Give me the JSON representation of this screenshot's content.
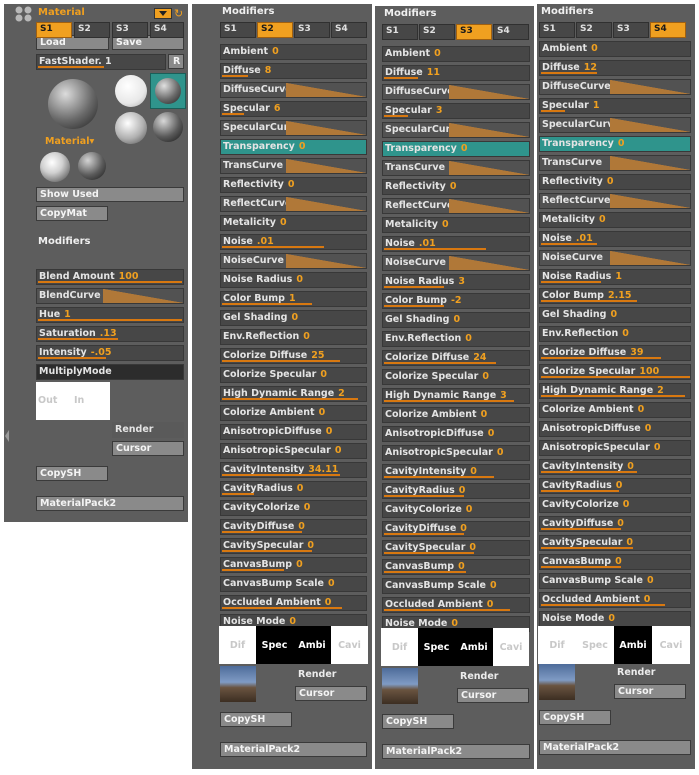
{
  "material_palette": {
    "title": "Material",
    "load_label": "Load",
    "save_label": "Save",
    "shader_name": "FastShader. 1",
    "r_label": "R",
    "material_menu_label": "Material",
    "show_used_label": "Show Used",
    "copymat_label": "CopyMat",
    "modifiers_label": "Modifiers",
    "slots": [
      "S1",
      "S2",
      "S3",
      "S4"
    ],
    "rows": [
      {
        "label": "Blend Amount",
        "value": "100"
      },
      {
        "label": "BlendCurve",
        "value": ""
      },
      {
        "label": "Hue",
        "value": "1"
      },
      {
        "label": "Saturation",
        "value": ".13"
      },
      {
        "label": "Intensity",
        "value": "-.05"
      },
      {
        "label": "MultiplyMode",
        "value": ""
      }
    ],
    "out_label": "Out",
    "in_label": "In",
    "render_label": "Render",
    "cursor_label": "Cursor",
    "copysh_label": "CopySH",
    "materialpack_label": "MaterialPack2"
  },
  "shader_panels": [
    {
      "modifiers_label": "Modifiers",
      "slots": [
        "S1",
        "S2",
        "S3",
        "S4"
      ],
      "active_slot": 1,
      "rows": [
        {
          "label": "Ambient",
          "value": "0"
        },
        {
          "label": "Diffuse",
          "value": "8"
        },
        {
          "label": "DiffuseCurve",
          "value": ""
        },
        {
          "label": "Specular",
          "value": "6"
        },
        {
          "label": "SpecularCurve",
          "value": ""
        },
        {
          "label": "Transparency",
          "value": "0"
        },
        {
          "label": "TransCurve",
          "value": ""
        },
        {
          "label": "Reflectivity",
          "value": "0"
        },
        {
          "label": "ReflectCurve",
          "value": ""
        },
        {
          "label": "Metalicity",
          "value": "0"
        },
        {
          "label": "Noise",
          "value": ".01"
        },
        {
          "label": "NoiseCurve",
          "value": ""
        },
        {
          "label": "Noise Radius",
          "value": "0"
        },
        {
          "label": "Color Bump",
          "value": "1"
        },
        {
          "label": "Gel Shading",
          "value": "0"
        },
        {
          "label": "Env.Reflection",
          "value": "0"
        },
        {
          "label": "Colorize Diffuse",
          "value": "25"
        },
        {
          "label": "Colorize Specular",
          "value": "0"
        },
        {
          "label": "High Dynamic Range",
          "value": "2"
        },
        {
          "label": "Colorize Ambient",
          "value": "0"
        },
        {
          "label": "AnisotropicDiffuse",
          "value": "0"
        },
        {
          "label": "AnisotropicSpecular",
          "value": "0"
        },
        {
          "label": "CavityIntensity",
          "value": "34.11"
        },
        {
          "label": "CavityRadius",
          "value": "0"
        },
        {
          "label": "CavityColorize",
          "value": "0"
        },
        {
          "label": "CavityDiffuse",
          "value": "0"
        },
        {
          "label": "CavitySpecular",
          "value": "0"
        },
        {
          "label": "CanvasBump",
          "value": "0"
        },
        {
          "label": "CanvasBump Scale",
          "value": "0"
        },
        {
          "label": "Occluded  Ambient",
          "value": "0"
        },
        {
          "label": "Noise Mode",
          "value": "0"
        }
      ],
      "channels": [
        "Dif",
        "Spec",
        "Ambi",
        "Cavi"
      ],
      "active_channel": 1,
      "render_label": "Render",
      "cursor_label": "Cursor",
      "copysh_label": "CopySH",
      "materialpack_label": "MaterialPack2"
    },
    {
      "modifiers_label": "Modifiers",
      "slots": [
        "S1",
        "S2",
        "S3",
        "S4"
      ],
      "active_slot": 2,
      "rows": [
        {
          "label": "Ambient",
          "value": "0"
        },
        {
          "label": "Diffuse",
          "value": "11"
        },
        {
          "label": "DiffuseCurve",
          "value": ""
        },
        {
          "label": "Specular",
          "value": "3"
        },
        {
          "label": "SpecularCurve",
          "value": ""
        },
        {
          "label": "Transparency",
          "value": "0"
        },
        {
          "label": "TransCurve",
          "value": ""
        },
        {
          "label": "Reflectivity",
          "value": "0"
        },
        {
          "label": "ReflectCurve",
          "value": ""
        },
        {
          "label": "Metalicity",
          "value": "0"
        },
        {
          "label": "Noise",
          "value": ".01"
        },
        {
          "label": "NoiseCurve",
          "value": ""
        },
        {
          "label": "Noise Radius",
          "value": "3"
        },
        {
          "label": "Color Bump",
          "value": "-2"
        },
        {
          "label": "Gel Shading",
          "value": "0"
        },
        {
          "label": "Env.Reflection",
          "value": "0"
        },
        {
          "label": "Colorize Diffuse",
          "value": "24"
        },
        {
          "label": "Colorize Specular",
          "value": "0"
        },
        {
          "label": "High Dynamic Range",
          "value": "3"
        },
        {
          "label": "Colorize Ambient",
          "value": "0"
        },
        {
          "label": "AnisotropicDiffuse",
          "value": "0"
        },
        {
          "label": "AnisotropicSpecular",
          "value": "0"
        },
        {
          "label": "CavityIntensity",
          "value": "0"
        },
        {
          "label": "CavityRadius",
          "value": "0"
        },
        {
          "label": "CavityColorize",
          "value": "0"
        },
        {
          "label": "CavityDiffuse",
          "value": "0"
        },
        {
          "label": "CavitySpecular",
          "value": "0"
        },
        {
          "label": "CanvasBump",
          "value": "0"
        },
        {
          "label": "CanvasBump Scale",
          "value": "0"
        },
        {
          "label": "Occluded  Ambient",
          "value": "0"
        },
        {
          "label": "Noise Mode",
          "value": "0"
        }
      ],
      "channels": [
        "Dif",
        "Spec",
        "Ambi",
        "Cavi"
      ],
      "active_channel": 1,
      "render_label": "Render",
      "cursor_label": "Cursor",
      "copysh_label": "CopySH",
      "materialpack_label": "MaterialPack2"
    },
    {
      "modifiers_label": "Modifiers",
      "slots": [
        "S1",
        "S2",
        "S3",
        "S4"
      ],
      "active_slot": 3,
      "rows": [
        {
          "label": "Ambient",
          "value": "0"
        },
        {
          "label": "Diffuse",
          "value": "12"
        },
        {
          "label": "DiffuseCurve",
          "value": ""
        },
        {
          "label": "Specular",
          "value": "1"
        },
        {
          "label": "SpecularCurve",
          "value": ""
        },
        {
          "label": "Transparency",
          "value": "0"
        },
        {
          "label": "TransCurve",
          "value": ""
        },
        {
          "label": "Reflectivity",
          "value": "0"
        },
        {
          "label": "ReflectCurve",
          "value": ""
        },
        {
          "label": "Metalicity",
          "value": "0"
        },
        {
          "label": "Noise",
          "value": ".01"
        },
        {
          "label": "NoiseCurve",
          "value": ""
        },
        {
          "label": "Noise Radius",
          "value": "1"
        },
        {
          "label": "Color Bump",
          "value": "2.15"
        },
        {
          "label": "Gel Shading",
          "value": "0"
        },
        {
          "label": "Env.Reflection",
          "value": "0"
        },
        {
          "label": "Colorize Diffuse",
          "value": "39"
        },
        {
          "label": "Colorize Specular",
          "value": "100"
        },
        {
          "label": "High Dynamic Range",
          "value": "2"
        },
        {
          "label": "Colorize Ambient",
          "value": "0"
        },
        {
          "label": "AnisotropicDiffuse",
          "value": "0"
        },
        {
          "label": "AnisotropicSpecular",
          "value": "0"
        },
        {
          "label": "CavityIntensity",
          "value": "0"
        },
        {
          "label": "CavityRadius",
          "value": "0"
        },
        {
          "label": "CavityColorize",
          "value": "0"
        },
        {
          "label": "CavityDiffuse",
          "value": "0"
        },
        {
          "label": "CavitySpecular",
          "value": "0"
        },
        {
          "label": "CanvasBump",
          "value": "0"
        },
        {
          "label": "CanvasBump Scale",
          "value": "0"
        },
        {
          "label": "Occluded  Ambient",
          "value": "0"
        },
        {
          "label": "Noise Mode",
          "value": "0"
        }
      ],
      "channels": [
        "Dif",
        "Spec",
        "Ambi",
        "Cavi"
      ],
      "active_channel": 2,
      "render_label": "Render",
      "cursor_label": "Cursor",
      "copysh_label": "CopySH",
      "materialpack_label": "MaterialPack2"
    }
  ],
  "colors": {
    "panel_bg": "#5d5d5d",
    "accent_orange": "#f0a020",
    "highlight_teal": "#2f948c",
    "curve_tan": "#b07838"
  }
}
